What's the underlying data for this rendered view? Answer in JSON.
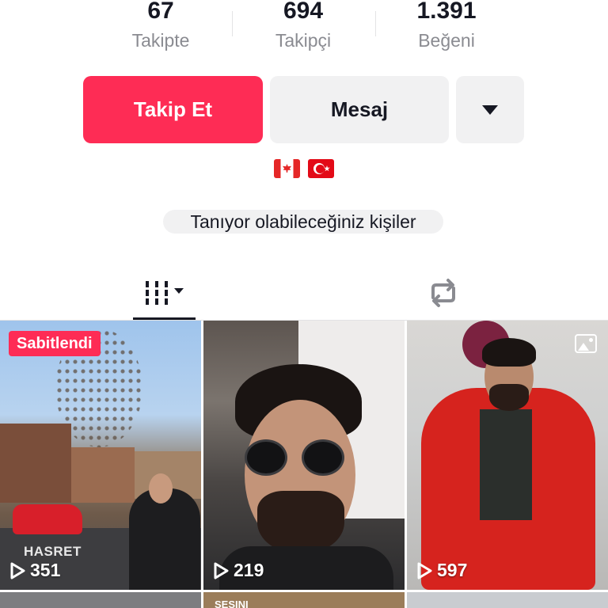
{
  "stats": [
    {
      "value": "67",
      "label": "Takipte"
    },
    {
      "value": "694",
      "label": "Takipçi"
    },
    {
      "value": "1.391",
      "label": "Beğeni"
    }
  ],
  "actions": {
    "follow_label": "Takip Et",
    "message_label": "Mesaj",
    "more_icon": "caret-down-icon"
  },
  "flags": [
    "🇨🇦",
    "🇹🇷"
  ],
  "suggest_label": "Tanıyor olabileceğiniz kişiler",
  "tabs": [
    {
      "icon": "videos-grid-icon",
      "active": true
    },
    {
      "icon": "repost-icon",
      "active": false
    }
  ],
  "colors": {
    "accent": "#fe2c55",
    "button_bg": "#f1f1f2",
    "text": "#161823",
    "muted": "#8a8b91"
  },
  "videos": [
    {
      "pinned_label": "Sabitlendi",
      "overlay": "HASRET",
      "views": "351"
    },
    {
      "views": "219"
    },
    {
      "views": "597",
      "is_photo": true
    },
    {},
    {
      "overlay": "SESINI"
    },
    {}
  ]
}
